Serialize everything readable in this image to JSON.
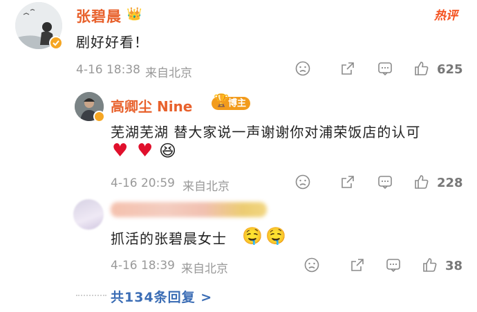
{
  "main_comment": {
    "author": "张碧晨",
    "hot_label": "热评",
    "text": "剧好好看！",
    "time": "4-16 18:38",
    "location": "来自北京",
    "likes": "625"
  },
  "reply1": {
    "author": "高卿尘 Nine",
    "badge": "博主",
    "text": "芜湖芜湖 替大家说一声谢谢你对浦荣饭店的认可",
    "time": "4-16 20:59",
    "location": "来自北京",
    "likes": "228"
  },
  "reply2": {
    "text": "抓活的张碧晨女士",
    "time": "4-16 18:39",
    "location": "来自北京",
    "likes": "38"
  },
  "footer": {
    "more_replies": "共134条回复 >"
  },
  "colors": {
    "name": "#e8612c",
    "link": "#3b6db5",
    "meta": "#999999",
    "heart": "#e0102c"
  }
}
